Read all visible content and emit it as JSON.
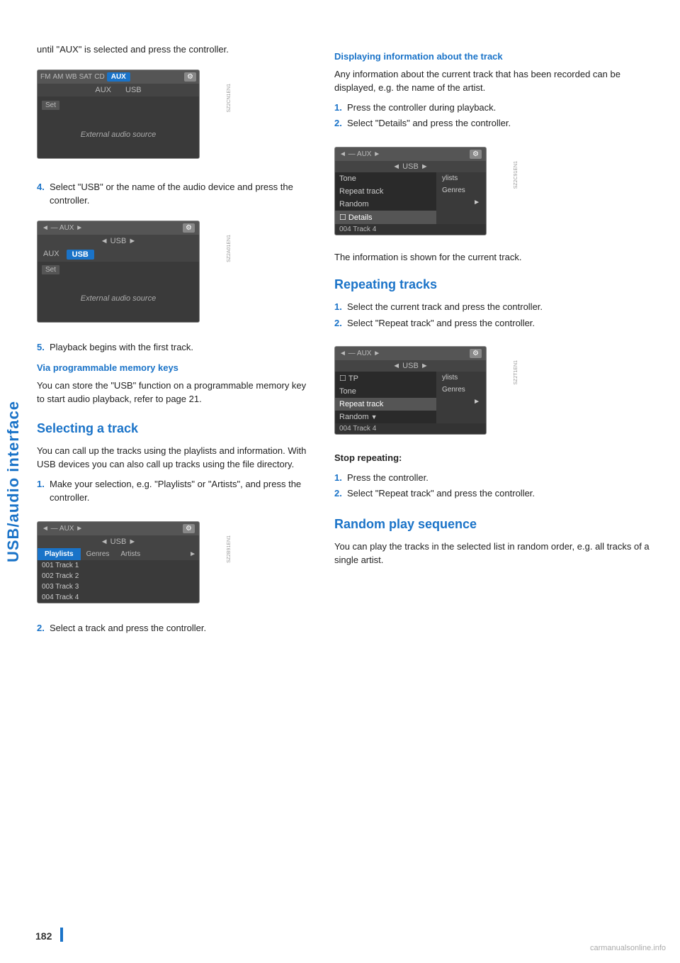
{
  "sidebar": {
    "label": "USB/audio interface"
  },
  "page_number": "182",
  "left_col": {
    "intro_text": "until \"AUX\" is selected and press the controller.",
    "step4": "Select \"USB\" or the name of the audio device and press the controller.",
    "step5": "Playback begins with the first track.",
    "via_prog_heading": "Via programmable memory keys",
    "via_prog_text": "You can store the \"USB\" function on a programmable memory key to start audio playback, refer to page 21.",
    "selecting_heading": "Selecting a track",
    "selecting_text": "You can call up the tracks using the playlists and information. With USB devices you can also call up tracks using the file directory.",
    "selecting_step1": "Make your selection, e.g. \"Playlists\" or \"Artists\", and press the controller.",
    "selecting_step2": "Select a track and press the controller."
  },
  "screens": {
    "aux_screen1": {
      "top_tabs": [
        "FM",
        "AM",
        "WB",
        "SAT",
        "CD",
        "AUX"
      ],
      "active_tab": "AUX",
      "second_row": [
        "AUX",
        "USB"
      ],
      "set_label": "Set",
      "body_text": "External audio source"
    },
    "aux_screen2": {
      "top_bar": "◄ — AUX ►",
      "second_bar": "◄ USB ►",
      "active_tab_left": "AUX",
      "active_tab_right": "USB",
      "set_label": "Set",
      "body_text": "External audio source"
    },
    "playlists_screen": {
      "top_bar": "◄ — AUX ►",
      "second_bar": "◄ USB ►",
      "tabs": [
        "Playlists",
        "Genres",
        "Artists"
      ],
      "active_tab": "Playlists",
      "tracks": [
        "001 Track 1",
        "002 Track 2",
        "003 Track 3",
        "004 Track 4"
      ]
    },
    "details_screen": {
      "top_bar": "◄ — AUX ►",
      "second_bar": "◄ USB ►",
      "tabs": [
        "ylists",
        "Genres"
      ],
      "menu_items": [
        "Tone",
        "Repeat track",
        "Random",
        "Details"
      ],
      "active_item": "Details",
      "status": "004 Track 4"
    },
    "repeat_screen": {
      "top_bar": "◄ — AUX ►",
      "second_bar": "◄ USB ►",
      "tabs": [
        "ylists",
        "Genres"
      ],
      "menu_items": [
        "TP",
        "Tone",
        "Repeat track",
        "Random"
      ],
      "active_item": "Repeat track",
      "status": "004 Track 4"
    }
  },
  "right_col": {
    "display_info_heading": "Displaying information about the track",
    "display_info_text": "Any information about the current track that has been recorded can be displayed, e.g. the name of the artist.",
    "display_step1": "Press the controller during playback.",
    "display_step2": "Select \"Details\" and press the controller.",
    "display_note": "The information is shown for the current track.",
    "repeating_heading": "Repeating tracks",
    "repeating_step1": "Select the current track and press the controller.",
    "repeating_step2": "Select \"Repeat track\" and press the controller.",
    "stop_repeating_heading": "Stop repeating:",
    "stop_step1": "Press the controller.",
    "stop_step2": "Select \"Repeat track\" and press the controller.",
    "random_heading": "Random play sequence",
    "random_text": "You can play the tracks in the selected list in random order, e.g. all tracks of a single artist."
  },
  "watermark": "carmanualsonline.info"
}
